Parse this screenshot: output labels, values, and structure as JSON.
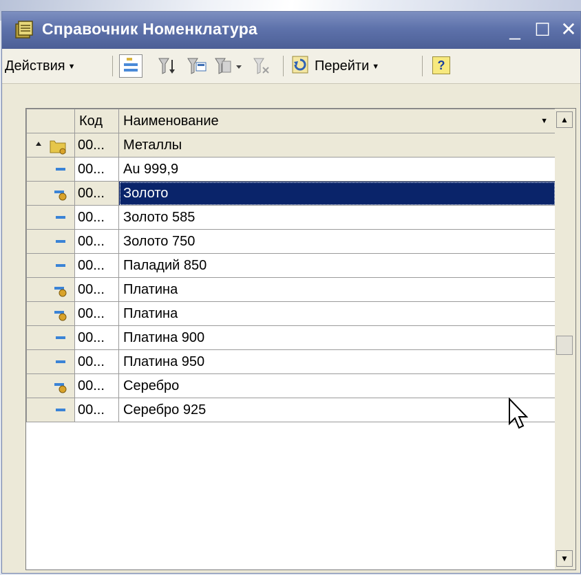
{
  "window": {
    "title": "Справочник Номенклатура",
    "minimize": "_",
    "maximize": "☐",
    "close": "✕"
  },
  "toolbar": {
    "actions_label": "Действия",
    "goto_label": "Перейти",
    "help_label": "?"
  },
  "table": {
    "columns": [
      "Код",
      "Наименование"
    ],
    "rows": [
      {
        "code": "00...",
        "name": "Металлы",
        "kind": "group"
      },
      {
        "code": "00...",
        "name": "Au 999,9",
        "kind": "item"
      },
      {
        "code": "00...",
        "name": "Золото",
        "kind": "item-sub"
      },
      {
        "code": "00...",
        "name": "Золото 585",
        "kind": "item"
      },
      {
        "code": "00...",
        "name": "Золото 750",
        "kind": "item"
      },
      {
        "code": "00...",
        "name": "Паладий 850",
        "kind": "item"
      },
      {
        "code": "00...",
        "name": "Платина",
        "kind": "item-sub"
      },
      {
        "code": "00...",
        "name": "Платина",
        "kind": "item-sub"
      },
      {
        "code": "00...",
        "name": "Платина 900",
        "kind": "item"
      },
      {
        "code": "00...",
        "name": "Платина 950",
        "kind": "item"
      },
      {
        "code": "00...",
        "name": "Серебро",
        "kind": "item-sub"
      },
      {
        "code": "00...",
        "name": "Серебро 925",
        "kind": "item"
      }
    ]
  },
  "colors": {
    "titlebar": "#5e72ab",
    "selection": "#0a246a"
  }
}
